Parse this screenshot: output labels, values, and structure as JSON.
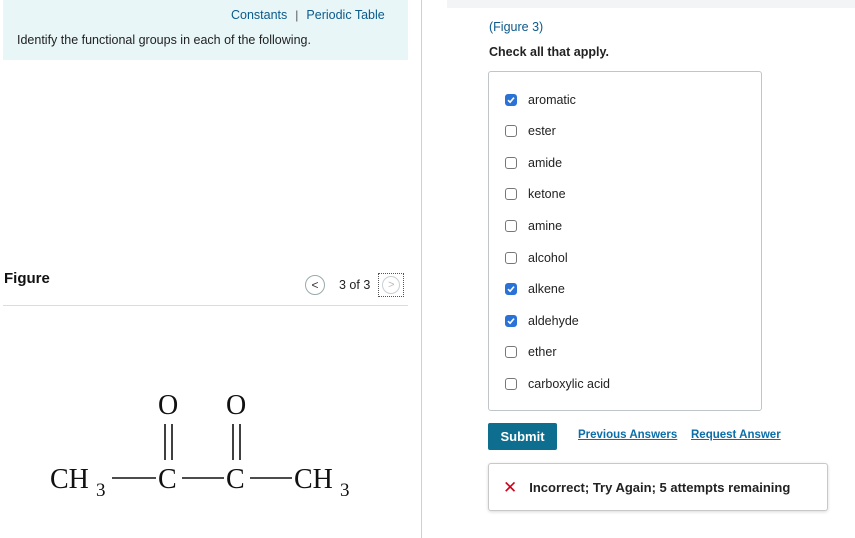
{
  "header": {
    "links": [
      "Constants",
      "Periodic Table"
    ],
    "separator": "|",
    "question": "Identify the functional groups in each of the following."
  },
  "figure": {
    "label": "Figure",
    "pager_text": "3 of 3",
    "prev_glyph": "<",
    "next_glyph": ">",
    "molecule": {
      "ch3_left": "CH",
      "c1": "C",
      "c2": "C",
      "ch3_right": "CH",
      "subscript": "3",
      "oxygen": "O"
    }
  },
  "answer": {
    "figure_ref": "(Figure 3)",
    "instruction": "Check all that apply.",
    "options": [
      {
        "label": "aromatic",
        "checked": true
      },
      {
        "label": "ester",
        "checked": false
      },
      {
        "label": "amide",
        "checked": false
      },
      {
        "label": "ketone",
        "checked": false
      },
      {
        "label": "amine",
        "checked": false
      },
      {
        "label": "alcohol",
        "checked": false
      },
      {
        "label": "alkene",
        "checked": true
      },
      {
        "label": "aldehyde",
        "checked": true
      },
      {
        "label": "ether",
        "checked": false
      },
      {
        "label": "carboxylic acid",
        "checked": false
      }
    ],
    "submit_label": "Submit",
    "previous_answers_label": "Previous Answers",
    "request_answer_label": "Request Answer",
    "feedback": {
      "icon": "close-icon",
      "text": "Incorrect; Try Again; 5 attempts remaining",
      "color": "#d0021b"
    }
  },
  "colors": {
    "accent": "#0e6e8f",
    "link": "#0b5a8a",
    "checkbox_checked": "#2a72d6",
    "info_bg": "#e8f6f8"
  }
}
